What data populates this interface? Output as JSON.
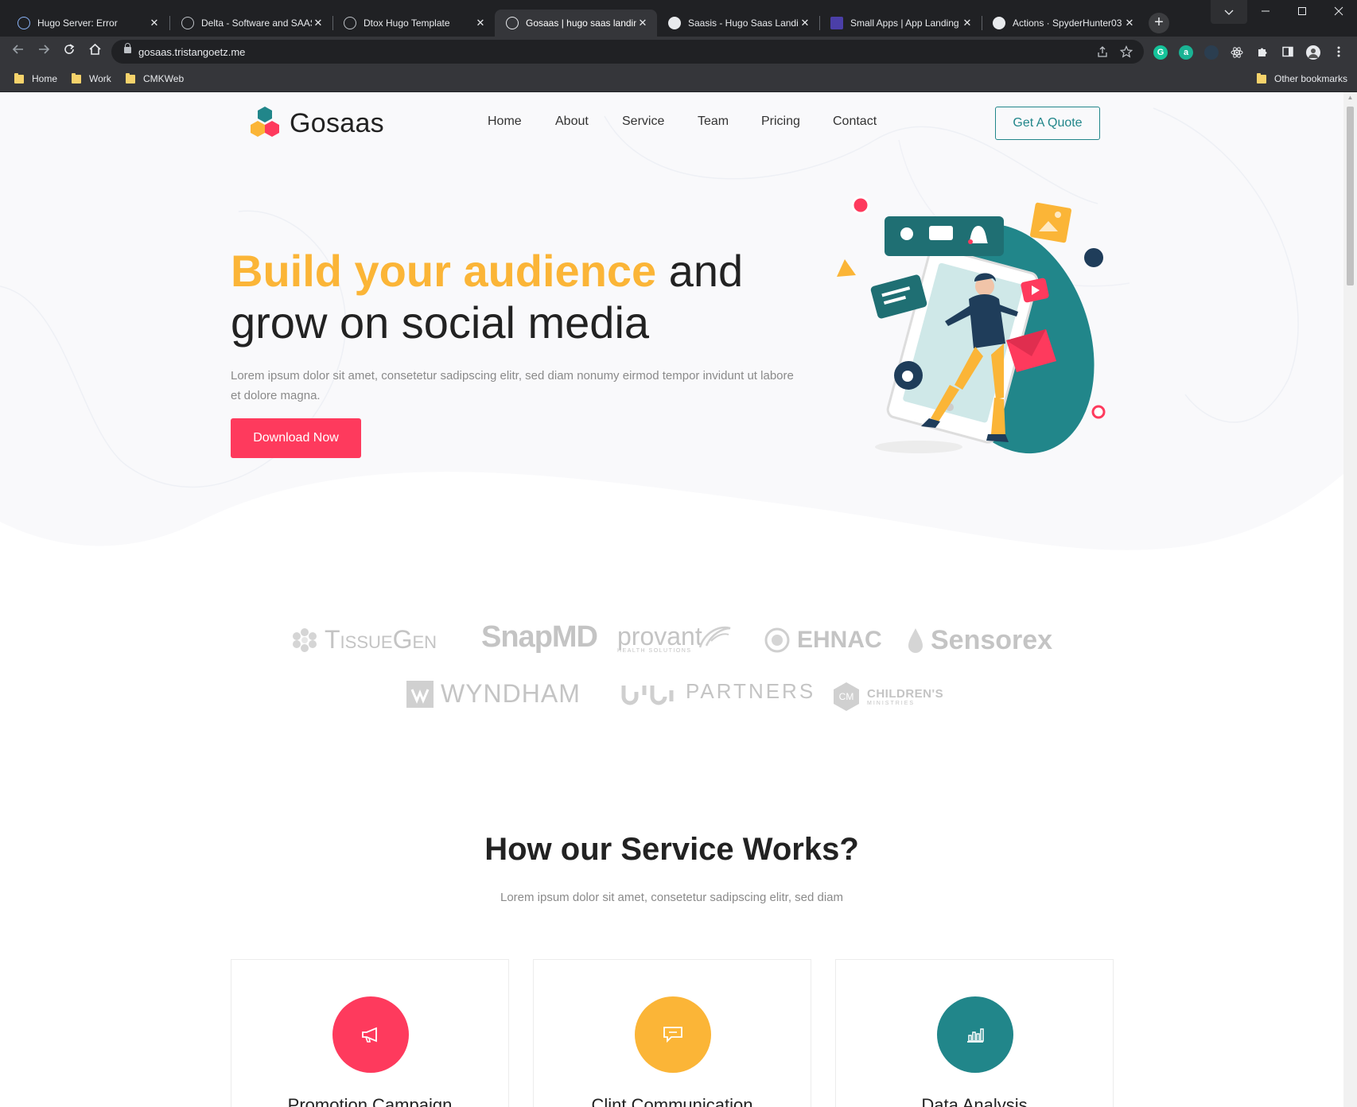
{
  "browser": {
    "tabs": [
      {
        "title": "Hugo Server: Error",
        "icon": "hugo-icon",
        "active": false
      },
      {
        "title": "Delta - Software and SAAS",
        "icon": "globe-icon",
        "active": false
      },
      {
        "title": "Dtox Hugo Template",
        "icon": "globe-icon",
        "active": false
      },
      {
        "title": "Gosaas | hugo saas landing",
        "icon": "globe-icon",
        "active": true
      },
      {
        "title": "Saasis - Hugo Saas Landing",
        "icon": "saasis-icon",
        "active": false
      },
      {
        "title": "Small Apps | App Landing",
        "icon": "app-icon",
        "active": false
      },
      {
        "title": "Actions · SpyderHunter03",
        "icon": "github-icon",
        "active": false
      }
    ],
    "close_glyph": "✕",
    "new_tab_glyph": "+",
    "url": "gosaas.tristangoetz.me",
    "bookmarks": [
      {
        "label": "Home"
      },
      {
        "label": "Work"
      },
      {
        "label": "CMKWeb"
      }
    ],
    "other_bookmarks": "Other bookmarks",
    "ext_grammarly": "G",
    "ext_a": "a"
  },
  "site": {
    "logo_text": "Gosaas",
    "nav": [
      {
        "label": "Home"
      },
      {
        "label": "About"
      },
      {
        "label": "Service"
      },
      {
        "label": "Team"
      },
      {
        "label": "Pricing"
      },
      {
        "label": "Contact"
      }
    ],
    "quote_button": "Get A Quote",
    "colors": {
      "yellow": "#fbb537",
      "red": "#fe3a5d",
      "teal": "#21868a"
    }
  },
  "hero": {
    "title_highlight": "Build your audience",
    "title_rest_line1": " and",
    "title_line2": "grow on social media",
    "text": "Lorem ipsum dolor sit amet, consetetur sadipscing elitr, sed diam nonumy eirmod tempor invidunt ut labore et dolore magna.",
    "button": "Download Now"
  },
  "brands": {
    "tissuegen": "TissueGen",
    "snapmd": "SnapMD",
    "provant": "provant",
    "provant_sub": "HEALTH SOLUTIONS",
    "ehnac": "EHNAC",
    "sensorex": "Sensorex",
    "wyndham": "WYNDHAM",
    "partners": "PARTNERS",
    "childrens": "CHILDREN'S",
    "childrens_sub": "MINISTRIES"
  },
  "services": {
    "title_pre": "How our Service ",
    "title_bold": "Works",
    "title_post": "?",
    "subtitle": "Lorem ipsum dolor sit amet, consetetur sadipscing elitr, sed diam",
    "cards": [
      {
        "title": "Promotion Campaign",
        "icon": "megaphone-icon",
        "color": "#fe3a5d"
      },
      {
        "title": "Clint Communication",
        "icon": "chat-icon",
        "color": "#fbb537"
      },
      {
        "title": "Data Analysis",
        "icon": "bar-chart-icon",
        "color": "#21868a"
      }
    ]
  }
}
